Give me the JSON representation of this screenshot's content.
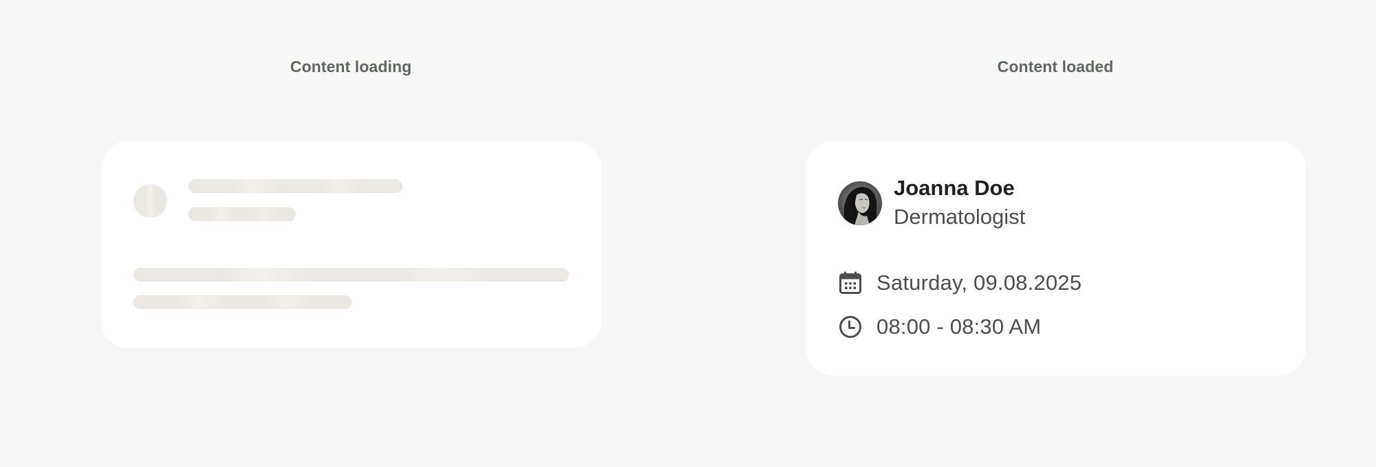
{
  "loading_section": {
    "label": "Content loading"
  },
  "loaded_section": {
    "label": "Content loaded",
    "card": {
      "name": "Joanna Doe",
      "role": "Dermatologist",
      "date": "Saturday, 09.08.2025",
      "time": "08:00 - 08:30 AM"
    }
  },
  "icons": {
    "date": "calendar-icon",
    "time": "clock-icon",
    "avatar": "avatar"
  },
  "colors": {
    "page_background": "#f6f7f6",
    "card_background": "#ffffff",
    "skeleton": "#ebe7e2",
    "section_label": "#5f6660",
    "name_text": "#1f2120",
    "body_text": "#4b4e4c"
  }
}
